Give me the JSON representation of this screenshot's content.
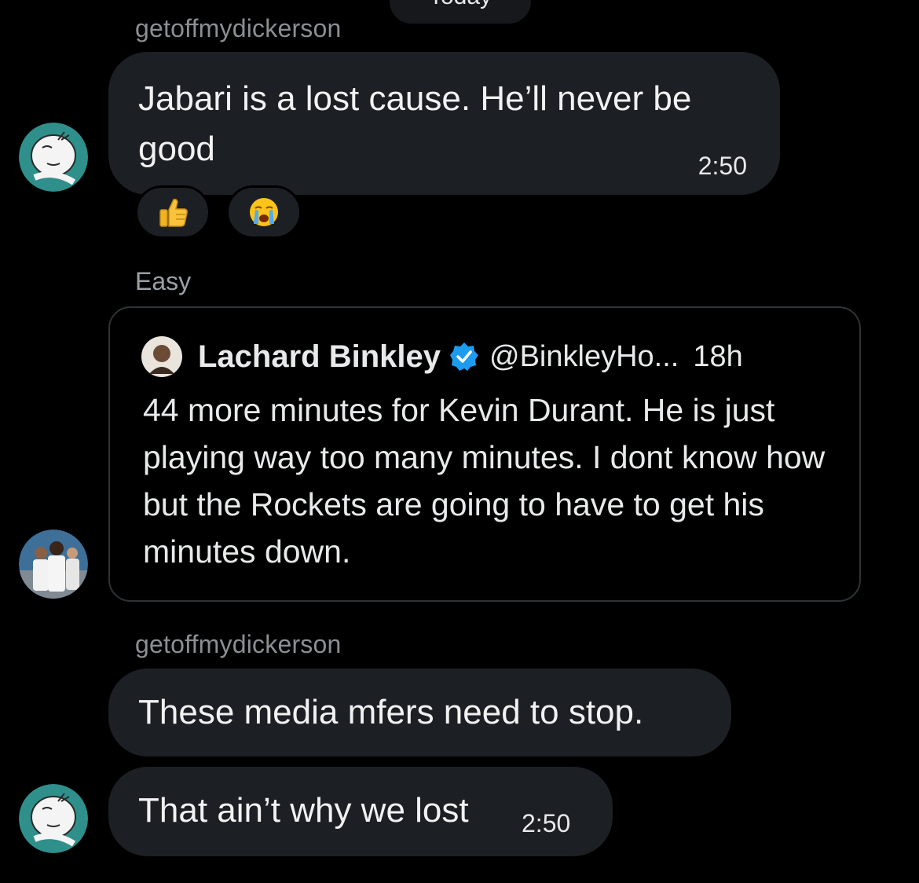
{
  "header": {
    "date_divider": "Today"
  },
  "messages": [
    {
      "sender": "getoffmydickerson",
      "text": "Jabari is a lost cause. He’ll never be good",
      "time": "2:50",
      "reactions": [
        {
          "emoji": "👍",
          "icon": "thumbs-up-icon"
        },
        {
          "emoji": "😭",
          "icon": "loudly-crying-face-icon"
        }
      ]
    },
    {
      "caption": "Easy",
      "quoted_post": {
        "author": "Lachard Binkley",
        "verified": true,
        "handle": "@BinkleyHo...",
        "age": "18h",
        "text": "44 more minutes for Kevin Durant. He is just playing way too many minutes. I dont know how but the Rockets are going to have to get his minutes down."
      }
    },
    {
      "sender": "getoffmydickerson",
      "text": "These media mfers need to stop."
    },
    {
      "text": "That ain’t why we lost",
      "time": "2:50"
    }
  ],
  "colors": {
    "background": "#000000",
    "bubble": "#1c1f23",
    "verified_badge": "#1d9bf0",
    "avatar_teal": "#2f8f8b"
  }
}
